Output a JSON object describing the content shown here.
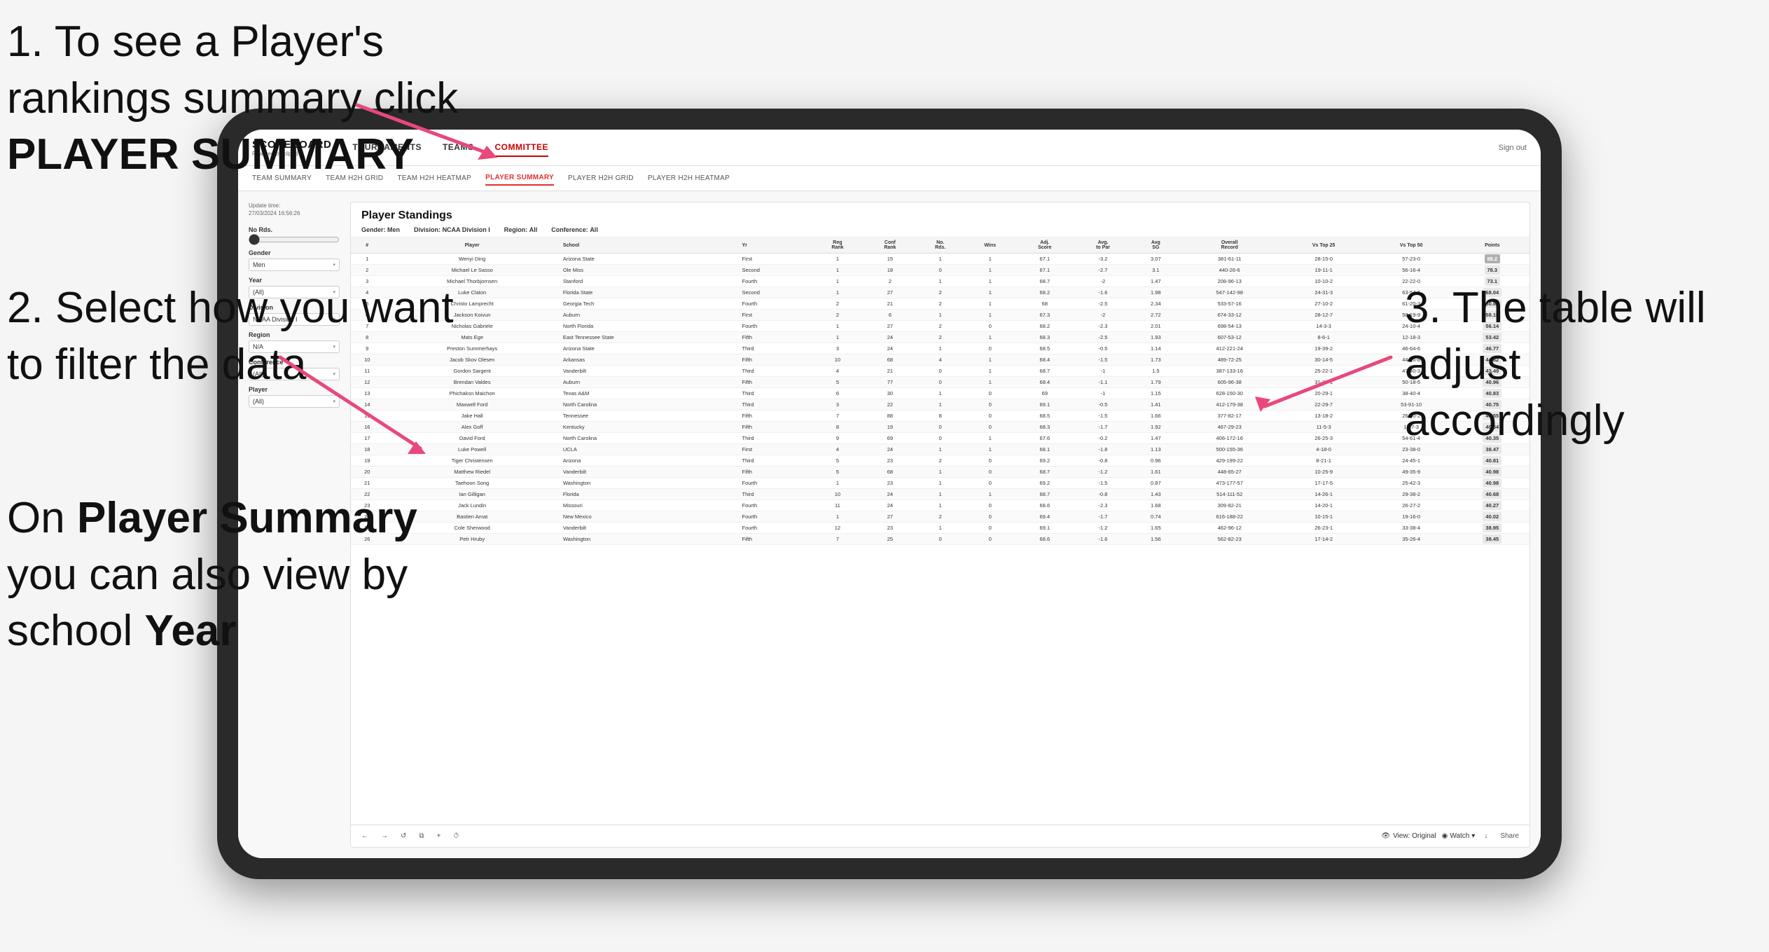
{
  "instructions": {
    "step1": "1. To see a Player's rankings summary click ",
    "step1_bold": "PLAYER SUMMARY",
    "step2_title": "2. Select how you want to filter the data",
    "step2_extra_prefix": "On ",
    "step2_extra_bold1": "Player Summary",
    "step2_extra_mid": " you can also view by school ",
    "step2_extra_bold2": "Year",
    "step3": "3. The table will adjust accordingly"
  },
  "header": {
    "logo_main": "SCOREBOARD",
    "logo_sub": "Powered by clippd",
    "nav": [
      "TOURNAMENTS",
      "TEAMS",
      "COMMITTEE"
    ],
    "sign_out": "Sign out"
  },
  "subnav": {
    "items": [
      "TEAM SUMMARY",
      "TEAM H2H GRID",
      "TEAM H2H HEATMAP",
      "PLAYER SUMMARY",
      "PLAYER H2H GRID",
      "PLAYER H2H HEATMAP"
    ],
    "active": "PLAYER SUMMARY"
  },
  "filters": {
    "update_label": "Update time:",
    "update_time": "27/03/2024 16:56:26",
    "no_rds_label": "No Rds.",
    "gender_label": "Gender",
    "gender_value": "Men",
    "year_label": "Year",
    "year_value": "(All)",
    "division_label": "Division",
    "division_value": "NCAA Division I",
    "region_label": "Region",
    "region_value": "N/A",
    "conference_label": "Conference",
    "conference_value": "(All)",
    "player_label": "Player",
    "player_value": "(All)"
  },
  "standings": {
    "title": "Player Standings",
    "gender_label": "Gender:",
    "gender_value": "Men",
    "division_label": "Division:",
    "division_value": "NCAA Division I",
    "region_label": "Region:",
    "region_value": "All",
    "conference_label": "Conference:",
    "conference_value": "All",
    "columns": [
      "#",
      "Player",
      "School",
      "Yr",
      "Reg Rank",
      "Conf Rank",
      "No. Rds.",
      "Wins",
      "Adj. Score to Par",
      "Avg SG",
      "Overall Record",
      "Vs Top 25",
      "Vs Top 50",
      "Points"
    ],
    "rows": [
      {
        "rank": 1,
        "player": "Wenyi Ding",
        "school": "Arizona State",
        "yr": "First",
        "reg_rank": 1,
        "conf_rank": 15,
        "no_rds": 1,
        "wins": 1,
        "adj_score": 67.1,
        "adj_to_par": -3.2,
        "avg_sg": 3.07,
        "record": "381-61-11",
        "vs25": "28-15-0",
        "vs50": "57-23-0",
        "points": "88.2"
      },
      {
        "rank": 2,
        "player": "Michael Le Sasso",
        "school": "Ole Miss",
        "yr": "Second",
        "reg_rank": 1,
        "conf_rank": 18,
        "no_rds": 0,
        "wins": 1,
        "adj_score": 67.1,
        "adj_to_par": -2.7,
        "avg_sg": 3.1,
        "record": "440-26-6",
        "vs25": "19-11-1",
        "vs50": "56-16-4",
        "points": "78.3"
      },
      {
        "rank": 3,
        "player": "Michael Thorbjornsen",
        "school": "Stanford",
        "yr": "Fourth",
        "reg_rank": 1,
        "conf_rank": 2,
        "no_rds": 1,
        "wins": 1,
        "adj_score": 68.7,
        "adj_to_par": -2.0,
        "avg_sg": 1.47,
        "record": "208-96-13",
        "vs25": "10-10-2",
        "vs50": "22-22-0",
        "points": "73.1"
      },
      {
        "rank": 4,
        "player": "Luke Claton",
        "school": "Florida State",
        "yr": "Second",
        "reg_rank": 1,
        "conf_rank": 27,
        "no_rds": 2,
        "wins": 1,
        "adj_score": 68.2,
        "adj_to_par": -1.6,
        "avg_sg": 1.98,
        "record": "547-142-98",
        "vs25": "24-31-3",
        "vs50": "63-54-6",
        "points": "68.04"
      },
      {
        "rank": 5,
        "player": "Christo Lamprecht",
        "school": "Georgia Tech",
        "yr": "Fourth",
        "reg_rank": 2,
        "conf_rank": 21,
        "no_rds": 2,
        "wins": 1,
        "adj_score": 68.0,
        "adj_to_par": -2.5,
        "avg_sg": 2.34,
        "record": "533-57-16",
        "vs25": "27-10-2",
        "vs50": "61-20-3",
        "points": "60.89"
      },
      {
        "rank": 6,
        "player": "Jackson Koivun",
        "school": "Auburn",
        "yr": "First",
        "reg_rank": 2,
        "conf_rank": 6,
        "no_rds": 1,
        "wins": 1,
        "adj_score": 67.3,
        "adj_to_par": -2.0,
        "avg_sg": 2.72,
        "record": "674-33-12",
        "vs25": "28-12-7",
        "vs50": "50-19-9",
        "points": "58.18"
      },
      {
        "rank": 7,
        "player": "Nicholas Gabriele",
        "school": "North Florida",
        "yr": "Fourth",
        "reg_rank": 1,
        "conf_rank": 27,
        "no_rds": 2,
        "wins": 0,
        "adj_score": 68.2,
        "adj_to_par": -2.3,
        "avg_sg": 2.01,
        "record": "698-54-13",
        "vs25": "14-3-3",
        "vs50": "24-10-4",
        "points": "56.14"
      },
      {
        "rank": 8,
        "player": "Mats Ege",
        "school": "East Tennessee State",
        "yr": "Fifth",
        "reg_rank": 1,
        "conf_rank": 24,
        "no_rds": 2,
        "wins": 1,
        "adj_score": 68.3,
        "adj_to_par": -2.5,
        "avg_sg": 1.93,
        "record": "607-53-12",
        "vs25": "8-6-1",
        "vs50": "12-18-3",
        "points": "53.42"
      },
      {
        "rank": 9,
        "player": "Preston Summerhays",
        "school": "Arizona State",
        "yr": "Third",
        "reg_rank": 3,
        "conf_rank": 24,
        "no_rds": 1,
        "wins": 0,
        "adj_score": 68.5,
        "adj_to_par": -0.5,
        "avg_sg": 1.14,
        "record": "412-221-24",
        "vs25": "19-39-2",
        "vs50": "46-64-6",
        "points": "46.77"
      },
      {
        "rank": 10,
        "player": "Jacob Skov Olesen",
        "school": "Arkansas",
        "yr": "Fifth",
        "reg_rank": 10,
        "conf_rank": 68,
        "no_rds": 4,
        "wins": 1,
        "adj_score": 68.4,
        "adj_to_par": -1.5,
        "avg_sg": 1.73,
        "record": "489-72-25",
        "vs25": "30-14-5",
        "vs50": "44-26-8",
        "points": "44.82"
      },
      {
        "rank": 11,
        "player": "Gordon Sargent",
        "school": "Vanderbilt",
        "yr": "Third",
        "reg_rank": 4,
        "conf_rank": 21,
        "no_rds": 0,
        "wins": 1,
        "adj_score": 68.7,
        "adj_to_par": -1.0,
        "avg_sg": 1.5,
        "record": "387-133-16",
        "vs25": "25-22-1",
        "vs50": "47-40-3",
        "points": "43.49"
      },
      {
        "rank": 12,
        "player": "Brendan Valdes",
        "school": "Auburn",
        "yr": "Fifth",
        "reg_rank": 5,
        "conf_rank": 77,
        "no_rds": 0,
        "wins": 1,
        "adj_score": 68.4,
        "adj_to_par": -1.1,
        "avg_sg": 1.79,
        "record": "605-96-38",
        "vs25": "31-15-1",
        "vs50": "50-18-5",
        "points": "40.96"
      },
      {
        "rank": 13,
        "player": "Phichaksn Maichon",
        "school": "Texas A&M",
        "yr": "Third",
        "reg_rank": 6,
        "conf_rank": 30,
        "no_rds": 1,
        "wins": 0,
        "adj_score": 69.0,
        "adj_to_par": -1.0,
        "avg_sg": 1.15,
        "record": "628-150-30",
        "vs25": "20-29-1",
        "vs50": "38-40-4",
        "points": "40.83"
      },
      {
        "rank": 14,
        "player": "Maxwell Ford",
        "school": "North Carolina",
        "yr": "Third",
        "reg_rank": 3,
        "conf_rank": 22,
        "no_rds": 1,
        "wins": 0,
        "adj_score": 69.1,
        "adj_to_par": -0.5,
        "avg_sg": 1.41,
        "record": "412-179-38",
        "vs25": "22-29-7",
        "vs50": "53-91-10",
        "points": "40.75"
      },
      {
        "rank": 15,
        "player": "Jake Hall",
        "school": "Tennessee",
        "yr": "Fifth",
        "reg_rank": 7,
        "conf_rank": 88,
        "no_rds": 8,
        "wins": 0,
        "adj_score": 68.5,
        "adj_to_par": -1.5,
        "avg_sg": 1.66,
        "record": "377-82-17",
        "vs25": "13-18-2",
        "vs50": "26-30-2",
        "points": "40.55"
      },
      {
        "rank": 16,
        "player": "Alex Goff",
        "school": "Kentucky",
        "yr": "Fifth",
        "reg_rank": 8,
        "conf_rank": 19,
        "no_rds": 0,
        "wins": 0,
        "adj_score": 68.3,
        "adj_to_par": -1.7,
        "avg_sg": 1.92,
        "record": "467-29-23",
        "vs25": "11-5-3",
        "vs50": "18-7-3",
        "points": "40.54"
      },
      {
        "rank": 17,
        "player": "David Ford",
        "school": "North Carolina",
        "yr": "Third",
        "reg_rank": 9,
        "conf_rank": 69,
        "no_rds": 0,
        "wins": 1,
        "adj_score": 67.6,
        "adj_to_par": -0.2,
        "avg_sg": 1.47,
        "record": "406-172-16",
        "vs25": "26-25-3",
        "vs50": "54-61-4",
        "points": "40.35"
      },
      {
        "rank": 18,
        "player": "Luke Powell",
        "school": "UCLA",
        "yr": "First",
        "reg_rank": 4,
        "conf_rank": 24,
        "no_rds": 1,
        "wins": 1,
        "adj_score": 68.1,
        "adj_to_par": -1.8,
        "avg_sg": 1.13,
        "record": "500-155-36",
        "vs25": "4-18-0",
        "vs50": "23-38-0",
        "points": "38.47"
      },
      {
        "rank": 19,
        "player": "Tiger Christensen",
        "school": "Arizona",
        "yr": "Third",
        "reg_rank": 5,
        "conf_rank": 23,
        "no_rds": 2,
        "wins": 0,
        "adj_score": 69.2,
        "adj_to_par": -0.8,
        "avg_sg": 0.96,
        "record": "429-199-22",
        "vs25": "8-21-1",
        "vs50": "24-45-1",
        "points": "40.81"
      },
      {
        "rank": 20,
        "player": "Matthew Riedel",
        "school": "Vanderbilt",
        "yr": "Fifth",
        "reg_rank": 5,
        "conf_rank": 68,
        "no_rds": 1,
        "wins": 0,
        "adj_score": 68.7,
        "adj_to_par": -1.2,
        "avg_sg": 1.61,
        "record": "448-65-27",
        "vs25": "10-25-9",
        "vs50": "49-35-9",
        "points": "40.98"
      },
      {
        "rank": 21,
        "player": "Taehoon Song",
        "school": "Washington",
        "yr": "Fourth",
        "reg_rank": 1,
        "conf_rank": 23,
        "no_rds": 1,
        "wins": 0,
        "adj_score": 69.2,
        "adj_to_par": -1.5,
        "avg_sg": 0.87,
        "record": "473-177-57",
        "vs25": "17-17-5",
        "vs50": "25-42-3",
        "points": "40.98"
      },
      {
        "rank": 22,
        "player": "Ian Gilligan",
        "school": "Florida",
        "yr": "Third",
        "reg_rank": 10,
        "conf_rank": 24,
        "no_rds": 1,
        "wins": 1,
        "adj_score": 68.7,
        "adj_to_par": -0.8,
        "avg_sg": 1.43,
        "record": "514-111-52",
        "vs25": "14-26-1",
        "vs50": "29-38-2",
        "points": "40.68"
      },
      {
        "rank": 23,
        "player": "Jack Lundin",
        "school": "Missouri",
        "yr": "Fourth",
        "reg_rank": 11,
        "conf_rank": 24,
        "no_rds": 1,
        "wins": 0,
        "adj_score": 68.6,
        "adj_to_par": -2.3,
        "avg_sg": 1.68,
        "record": "309-82-21",
        "vs25": "14-20-1",
        "vs50": "26-27-2",
        "points": "40.27"
      },
      {
        "rank": 24,
        "player": "Bastien Amat",
        "school": "New Mexico",
        "yr": "Fourth",
        "reg_rank": 1,
        "conf_rank": 27,
        "no_rds": 2,
        "wins": 0,
        "adj_score": 69.4,
        "adj_to_par": -1.7,
        "avg_sg": 0.74,
        "record": "616-188-22",
        "vs25": "10-15-1",
        "vs50": "19-16-0",
        "points": "40.02"
      },
      {
        "rank": 25,
        "player": "Cole Sherwood",
        "school": "Vanderbilt",
        "yr": "Fourth",
        "reg_rank": 12,
        "conf_rank": 23,
        "no_rds": 1,
        "wins": 0,
        "adj_score": 69.1,
        "adj_to_par": -1.2,
        "avg_sg": 1.65,
        "record": "462-96-12",
        "vs25": "26-23-1",
        "vs50": "33-38-4",
        "points": "38.95"
      },
      {
        "rank": 26,
        "player": "Petr Hruby",
        "school": "Washington",
        "yr": "Fifth",
        "reg_rank": 7,
        "conf_rank": 25,
        "no_rds": 0,
        "wins": 0,
        "adj_score": 68.6,
        "adj_to_par": -1.6,
        "avg_sg": 1.56,
        "record": "562-82-23",
        "vs25": "17-14-2",
        "vs50": "35-26-4",
        "points": "38.45"
      }
    ]
  },
  "toolbar": {
    "back": "←",
    "forward": "→",
    "refresh": "↺",
    "copy": "⧉",
    "add": "+",
    "clock": "⏱",
    "view_label": "View: Original",
    "watch_label": "Watch",
    "download_label": "↓",
    "share_label": "Share"
  }
}
